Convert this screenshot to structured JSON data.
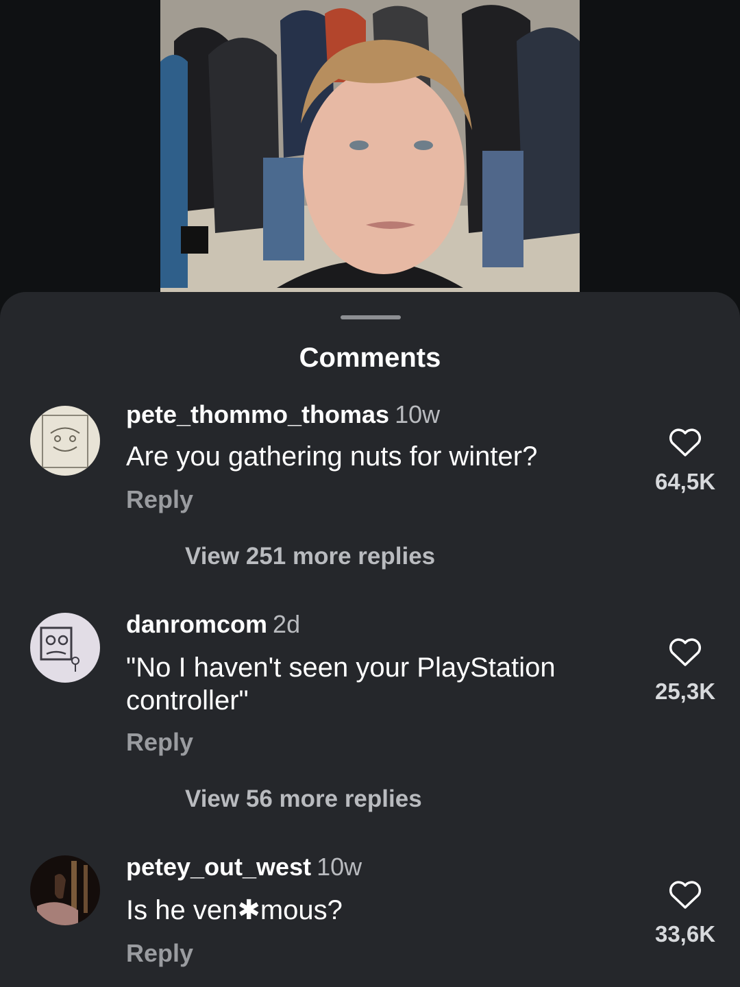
{
  "sheet": {
    "title": "Comments"
  },
  "comments": [
    {
      "username": "pete_thommo_thomas",
      "time": "10w",
      "text": "Are you gathering nuts for winter?",
      "reply_label": "Reply",
      "likes": "64,5K",
      "view_replies": "View 251 more replies"
    },
    {
      "username": "danromcom",
      "time": "2d",
      "text": "\"No I haven't seen your PlayStation controller\"",
      "reply_label": "Reply",
      "likes": "25,3K",
      "view_replies": "View 56 more replies"
    },
    {
      "username": "petey_out_west",
      "time": "10w",
      "text": "Is he ven✱mous?",
      "reply_label": "Reply",
      "likes": "33,6K"
    }
  ],
  "icons": {
    "like": "heart-outline-icon"
  },
  "colors": {
    "sheet_background": "#25272b",
    "page_background": "#0f1113",
    "secondary_text": "#9a9ca0"
  }
}
